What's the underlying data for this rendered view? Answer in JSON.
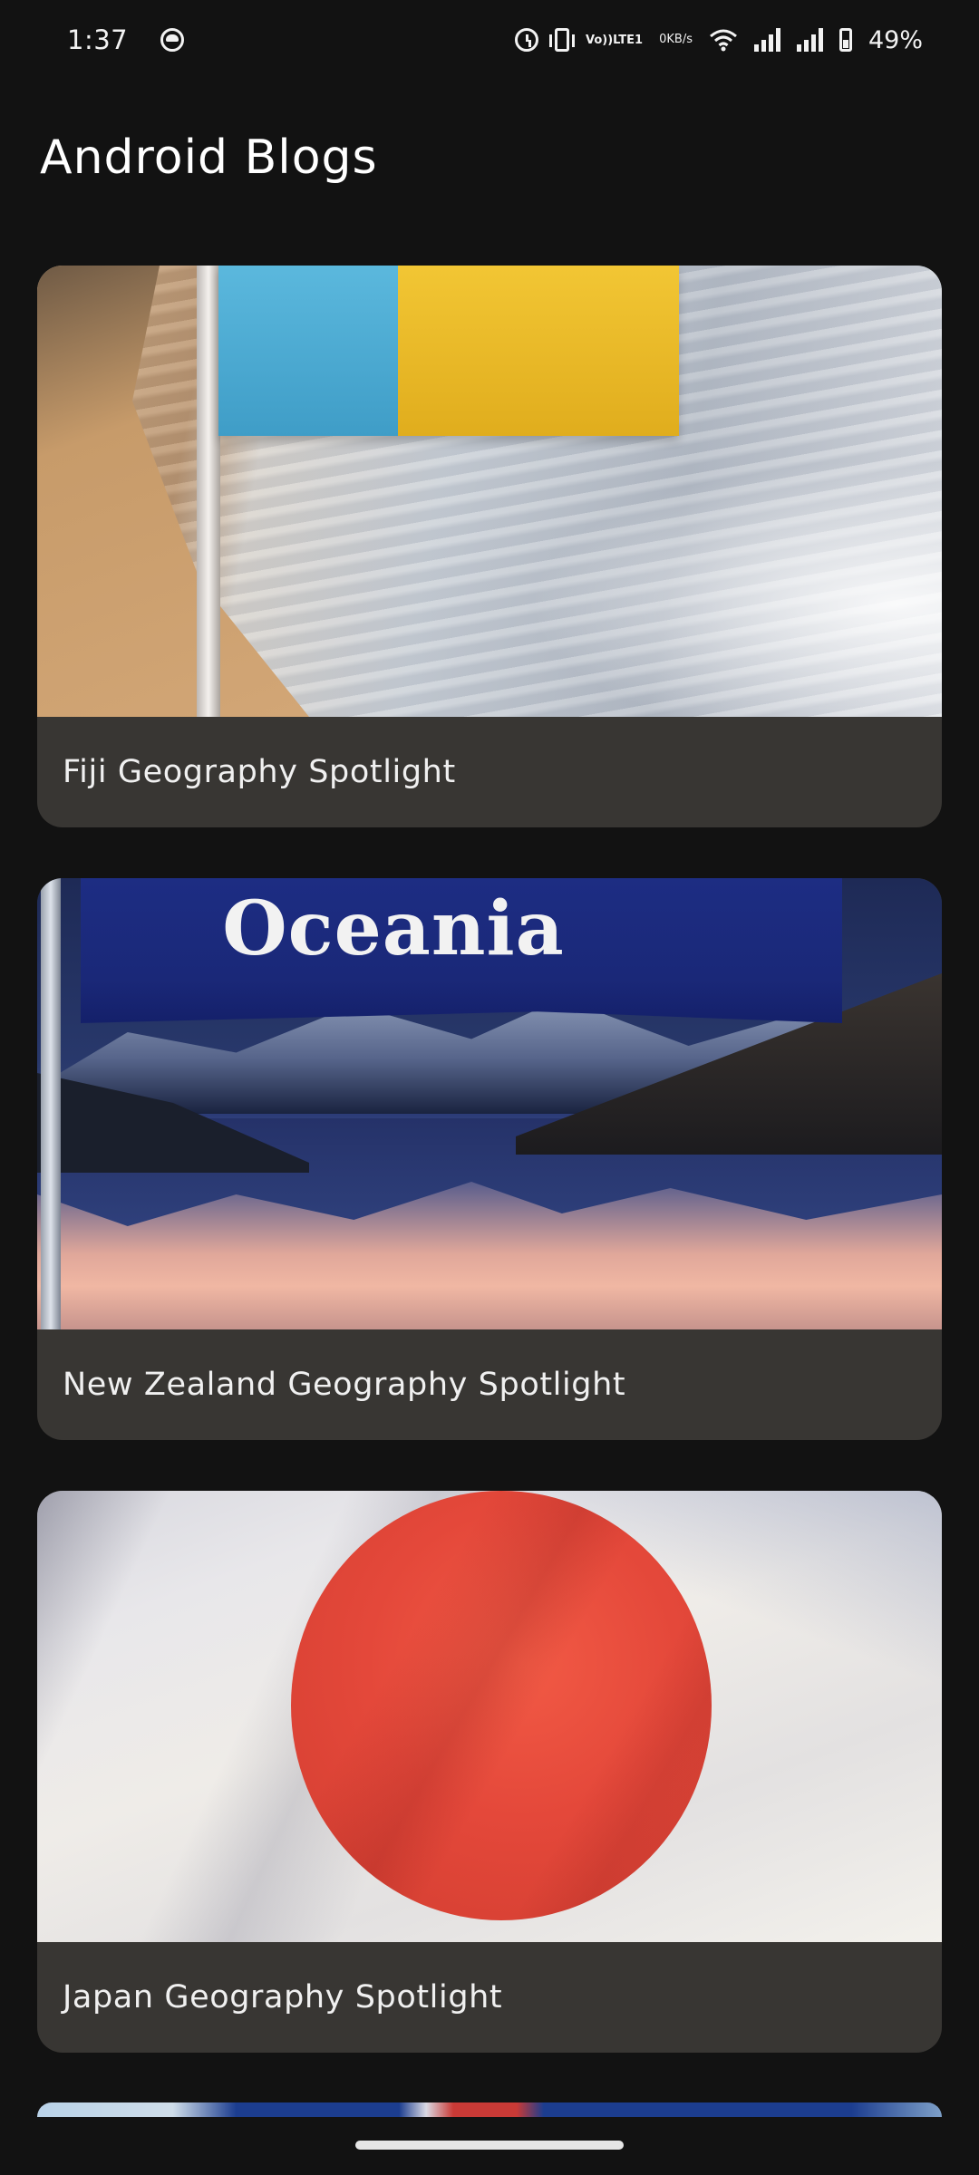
{
  "status_bar": {
    "time": "1:37",
    "volte_line1": "Vo))",
    "volte_line2": "LTE1",
    "speed_value": "0",
    "speed_unit": "KB/s",
    "battery": "49%"
  },
  "header": {
    "title": "Android Blogs"
  },
  "posts": [
    {
      "title": "Fiji Geography Spotlight",
      "image": "fiji-flag-beach"
    },
    {
      "title": "New Zealand Geography Spotlight",
      "image": "oceania-banner-lake",
      "image_text": "Oceania"
    },
    {
      "title": "Japan Geography Spotlight",
      "image": "japan-flag"
    }
  ],
  "colors": {
    "background": "#121212",
    "card": "#383633",
    "text": "#ffffff"
  }
}
